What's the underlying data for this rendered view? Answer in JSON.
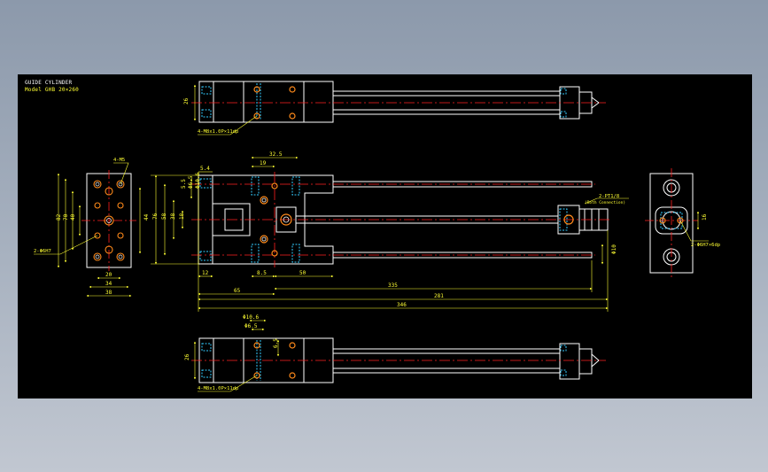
{
  "title_block": {
    "title": "GUIDE CYLINDER",
    "model_label": "Model",
    "model_value": "GHB 20×260"
  },
  "callouts": {
    "top_tap": "4-M8x1.0P×11dp",
    "bottom_tap": "4-M8x1.0P×11dp",
    "side_nuts": "4-M5",
    "side_pins": "2-Φ6H7",
    "port": "2-PT1/8",
    "port_note": "(Both Connection)",
    "end_pins": "2-Φ6H7×6dp"
  },
  "top_view": {
    "h": "26"
  },
  "bottom_view": {
    "h": "26",
    "d1": "Φ10.6",
    "d2": "Φ6.5",
    "d3": "6.5"
  },
  "side_view": {
    "h_outer": "82",
    "h_mid": "70",
    "h_in": "40",
    "h_core": "44",
    "w_20": "20",
    "w_34": "34",
    "w_38": "38"
  },
  "front_view": {
    "d_5_4": "5.4",
    "d_19": "19",
    "d_32_5": "32.5",
    "v_76": "76",
    "v_58": "58",
    "v_38": "38",
    "v_18": "18",
    "v_phi6_5": "Φ6.5",
    "v_phi10_6": "Φ10.6",
    "v_5_5": "5.5",
    "b_12": "12",
    "b_8_5": "8.5",
    "b_50": "50",
    "l_65": "65",
    "l_335": "335",
    "l_281": "281",
    "l_346": "346",
    "rod_dia": "Φ10"
  },
  "end_view": {
    "h": "16"
  },
  "colors": {
    "outline": "#ffffff",
    "centerline": "#ff2020",
    "dimension": "#ffff33",
    "hidden": "#33ccff",
    "hole": "#ff8a1a",
    "frame": "#000000"
  }
}
